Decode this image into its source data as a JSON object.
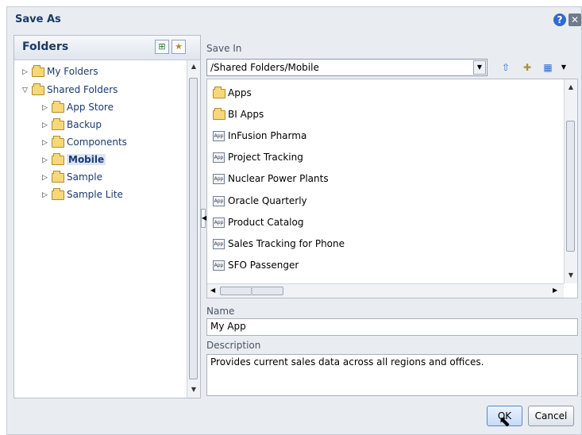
{
  "dialog": {
    "title": "Save As"
  },
  "folders": {
    "header": "Folders",
    "tree": [
      {
        "label": "My Folders",
        "expanded": false,
        "level": 0
      },
      {
        "label": "Shared Folders",
        "expanded": true,
        "level": 0
      },
      {
        "label": "App Store",
        "expanded": false,
        "level": 1
      },
      {
        "label": "Backup",
        "expanded": false,
        "level": 1
      },
      {
        "label": "Components",
        "expanded": false,
        "level": 1
      },
      {
        "label": "Mobile",
        "expanded": false,
        "level": 1,
        "selected": true
      },
      {
        "label": "Sample",
        "expanded": false,
        "level": 1
      },
      {
        "label": "Sample Lite",
        "expanded": false,
        "level": 1
      }
    ]
  },
  "save_in": {
    "label": "Save In",
    "path": "/Shared Folders/Mobile"
  },
  "list_items": [
    {
      "label": "Apps",
      "type": "folder"
    },
    {
      "label": "BI Apps",
      "type": "folder"
    },
    {
      "label": "InFusion Pharma",
      "type": "app"
    },
    {
      "label": "Project Tracking",
      "type": "app"
    },
    {
      "label": "Nuclear Power Plants",
      "type": "app"
    },
    {
      "label": "Oracle Quarterly",
      "type": "app"
    },
    {
      "label": "Product Catalog",
      "type": "app"
    },
    {
      "label": "Sales Tracking for Phone",
      "type": "app"
    },
    {
      "label": "SFO Passenger",
      "type": "app"
    }
  ],
  "app_icon_text": "App",
  "name_field": {
    "label": "Name",
    "value": "My App"
  },
  "description_field": {
    "label": "Description",
    "value": "Provides current sales data across all regions and offices."
  },
  "buttons": {
    "ok": "OK",
    "cancel": "Cancel"
  },
  "icons": {
    "help": "help-icon",
    "close": "close-icon",
    "tree_view": "tree-view-icon",
    "favorites": "favorites-icon",
    "up_folder": "up-folder-icon",
    "new_folder": "new-folder-icon",
    "view_options": "view-options-icon"
  }
}
